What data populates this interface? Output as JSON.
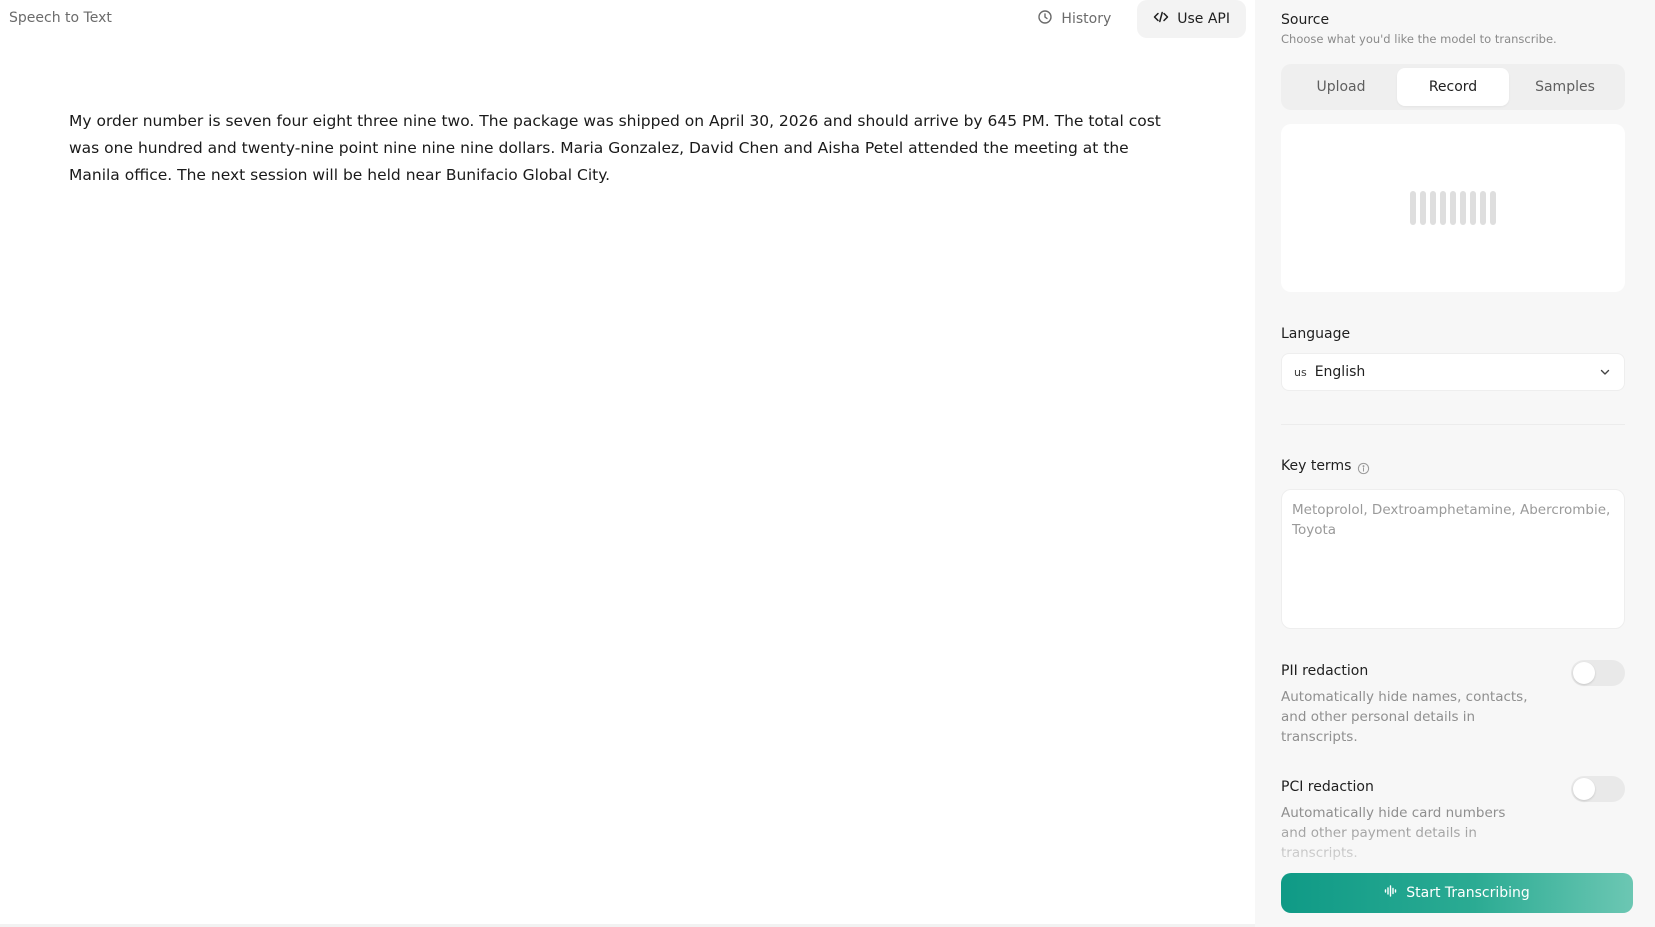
{
  "app": {
    "title": "Speech to Text"
  },
  "topbar": {
    "history_label": "History",
    "api_label": "Use API"
  },
  "transcript": {
    "text": "My order number is seven four eight three nine two. The package was shipped on April 30, 2026 and should arrive by 645 PM. The total cost was one hundred and twenty-nine point nine nine nine dollars. Maria Gonzalez, David Chen and Aisha Petel attended the meeting at the Manila office. The next session will be held near Bunifacio Global City."
  },
  "sidebar": {
    "source": {
      "label": "Source",
      "description": "Choose what you'd like the model to transcribe.",
      "tabs": [
        {
          "label": "Upload"
        },
        {
          "label": "Record"
        },
        {
          "label": "Samples"
        }
      ],
      "active_tab": "Record"
    },
    "language": {
      "label": "Language",
      "code": "us",
      "value": "English"
    },
    "key_terms": {
      "label": "Key terms",
      "placeholder": "Metoprolol, Dextroamphetamine, Abercrombie, Toyota",
      "value": ""
    },
    "pii": {
      "label": "PII redaction",
      "description": "Automatically hide names, contacts, and other personal details in transcripts.",
      "enabled": false
    },
    "pci": {
      "label": "PCI redaction",
      "description": "Automatically hide card numbers and other payment details in transcripts.",
      "enabled": false
    },
    "start_button": {
      "label": "Start Transcribing"
    }
  },
  "colors": {
    "accent_start": "#0f9a86",
    "accent_end": "#6cc7b3",
    "sidebar_bg": "#f7f7f7"
  }
}
